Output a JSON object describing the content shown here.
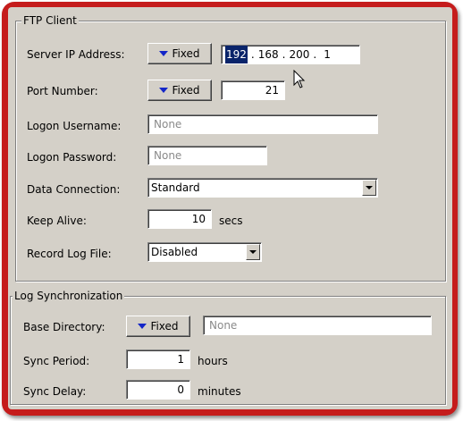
{
  "ftp_client": {
    "title": "FTP Client",
    "server_ip": {
      "label": "Server IP Address:",
      "mode": "Fixed",
      "octets": [
        "192",
        "168",
        "200",
        "1"
      ]
    },
    "port": {
      "label": "Port Number:",
      "mode": "Fixed",
      "value": "21"
    },
    "username": {
      "label": "Logon Username:",
      "placeholder": "None"
    },
    "password": {
      "label": "Logon Password:",
      "placeholder": "None"
    },
    "data_connection": {
      "label": "Data Connection:",
      "value": "Standard"
    },
    "keep_alive": {
      "label": "Keep Alive:",
      "value": "10",
      "unit": "secs"
    },
    "record_log": {
      "label": "Record Log File:",
      "value": "Disabled"
    }
  },
  "log_sync": {
    "title": "Log Synchronization",
    "base_directory": {
      "label": "Base Directory:",
      "mode": "Fixed",
      "placeholder": "None"
    },
    "sync_period": {
      "label": "Sync Period:",
      "value": "1",
      "unit": "hours"
    },
    "sync_delay": {
      "label": "Sync Delay:",
      "value": "0",
      "unit": "minutes"
    }
  },
  "colors": {
    "frame": "#c51c1c",
    "panel": "#d4d0c8",
    "selection": "#0a246a",
    "dropdown_triangle": "#1426c8"
  },
  "icons": [
    "chevron-down-icon",
    "dropdown-arrow-icon",
    "mouse-pointer-icon"
  ]
}
